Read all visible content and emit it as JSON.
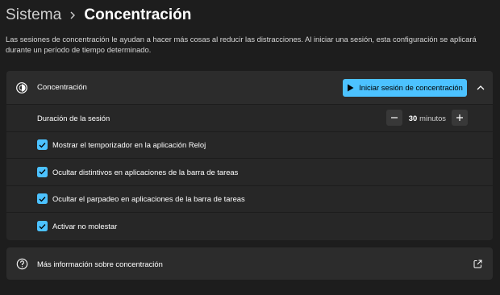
{
  "header": {
    "parent": "Sistema",
    "current": "Concentración"
  },
  "description": "Las sesiones de concentración le ayudan a hacer más cosas al reducir las distracciones. Al iniciar una sesión, esta configuración se aplicará durante un período de tiempo determinado.",
  "focus_card": {
    "title": "Concentración",
    "start_button_label": "Iniciar sesión de concentración",
    "duration": {
      "label": "Duración de la sesión",
      "value": "30",
      "unit": "minutos"
    },
    "options": [
      {
        "label": "Mostrar el temporizador en la aplicación Reloj",
        "checked": true
      },
      {
        "label": "Ocultar distintivos en aplicaciones de la barra de tareas",
        "checked": true
      },
      {
        "label": "Ocultar el parpadeo en aplicaciones de la barra de tareas",
        "checked": true
      },
      {
        "label": "Activar no molestar",
        "checked": true
      }
    ]
  },
  "info_card": {
    "label": "Más información sobre concentración"
  },
  "colors": {
    "background": "#1d1d1d",
    "card": "#272727",
    "accent": "#4cc2ff"
  }
}
